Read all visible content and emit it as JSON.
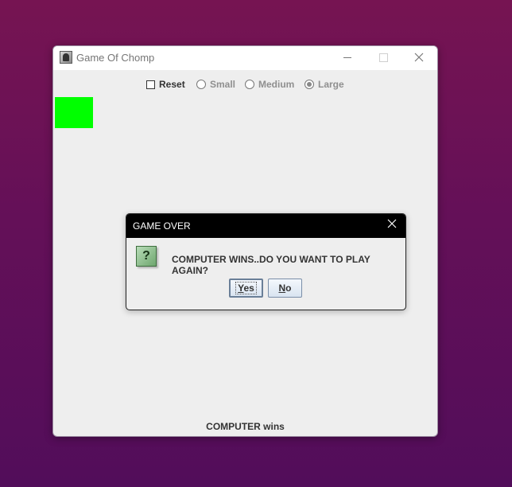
{
  "window": {
    "title": "Game Of Chomp"
  },
  "options": {
    "reset_label": "Reset",
    "reset_checked": false,
    "small_label": "Small",
    "medium_label": "Medium",
    "large_label": "Large",
    "selected_size": "Large"
  },
  "board": {
    "square_color": "#00ff00"
  },
  "status": {
    "text": "COMPUTER wins"
  },
  "dialog": {
    "title": "GAME OVER",
    "message": "COMPUTER WINS..DO YOU WANT TO PLAY AGAIN?",
    "yes_mnemonic": "Y",
    "yes_rest": "es",
    "no_mnemonic": "N",
    "no_rest": "o",
    "icon": "question-icon"
  }
}
